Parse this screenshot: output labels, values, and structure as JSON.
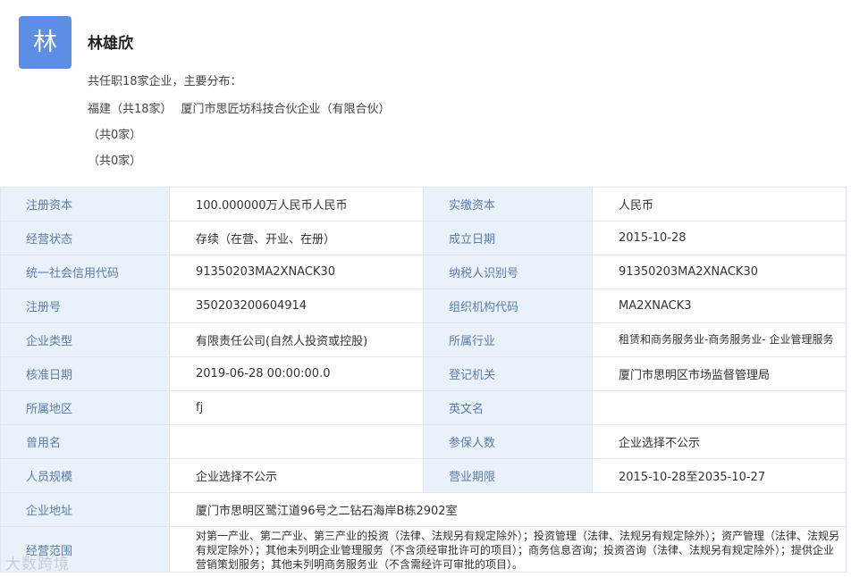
{
  "person": {
    "avatar_char": "林",
    "name": "林雄欣",
    "summary": "共任职18家企业，主要分布：",
    "region_1": "福建（共18家）",
    "region_1_company": "厦门市思匠坊科技合伙企业（有限合伙）",
    "region_2": "（共0家）",
    "region_3": "（共0家）"
  },
  "table": {
    "rows": [
      {
        "label1": "注册资本",
        "value1": "100.000000万人民币人民币",
        "label2": "实缴资本",
        "value2": "人民币"
      },
      {
        "label1": "经营状态",
        "value1": "存续（在营、开业、在册）",
        "label2": "成立日期",
        "value2": "2015-10-28"
      },
      {
        "label1": "统一社会信用代码",
        "value1": "91350203MA2XNACK30",
        "label2": "纳税人识别号",
        "value2": "91350203MA2XNACK30"
      },
      {
        "label1": "注册号",
        "value1": "350203200604914",
        "label2": "组织机构代码",
        "value2": "MA2XNACK3"
      },
      {
        "label1": "企业类型",
        "value1": "有限责任公司(自然人投资或控股)",
        "label2": "所属行业",
        "value2": "租赁和商务服务业-商务服务业- 企业管理服务"
      },
      {
        "label1": "核准日期",
        "value1": "2019-06-28 00:00:00.0",
        "label2": "登记机关",
        "value2": "厦门市思明区市场监督管理局"
      },
      {
        "label1": "所属地区",
        "value1": "fj",
        "label2": "英文名",
        "value2": ""
      },
      {
        "label1": "曾用名",
        "value1": "",
        "label2": "参保人数",
        "value2": "企业选择不公示"
      },
      {
        "label1": "人员规模",
        "value1": "企业选择不公示",
        "label2": "营业期限",
        "value2": "2015-10-28至2035-10-27"
      }
    ],
    "address_label": "企业地址",
    "address_value": "厦门市思明区鹭江道96号之二钻石海岸B栋2902室",
    "scope_label": "经营范围",
    "scope_value": "对第一产业、第二产业、第三产业的投资（法律、法规另有规定除外）；投资管理（法律、法规另有规定除外）；资产管理（法律、法规另有规定除外）；其他未列明企业管理服务（不含须经审批许可的项目）；商务信息咨询；投资咨询（法律、法规另有规定除外）；提供企业营销策划服务；其他未列明商务服务业（不含需经许可审批的项目）。"
  },
  "watermark": "大数跨境"
}
